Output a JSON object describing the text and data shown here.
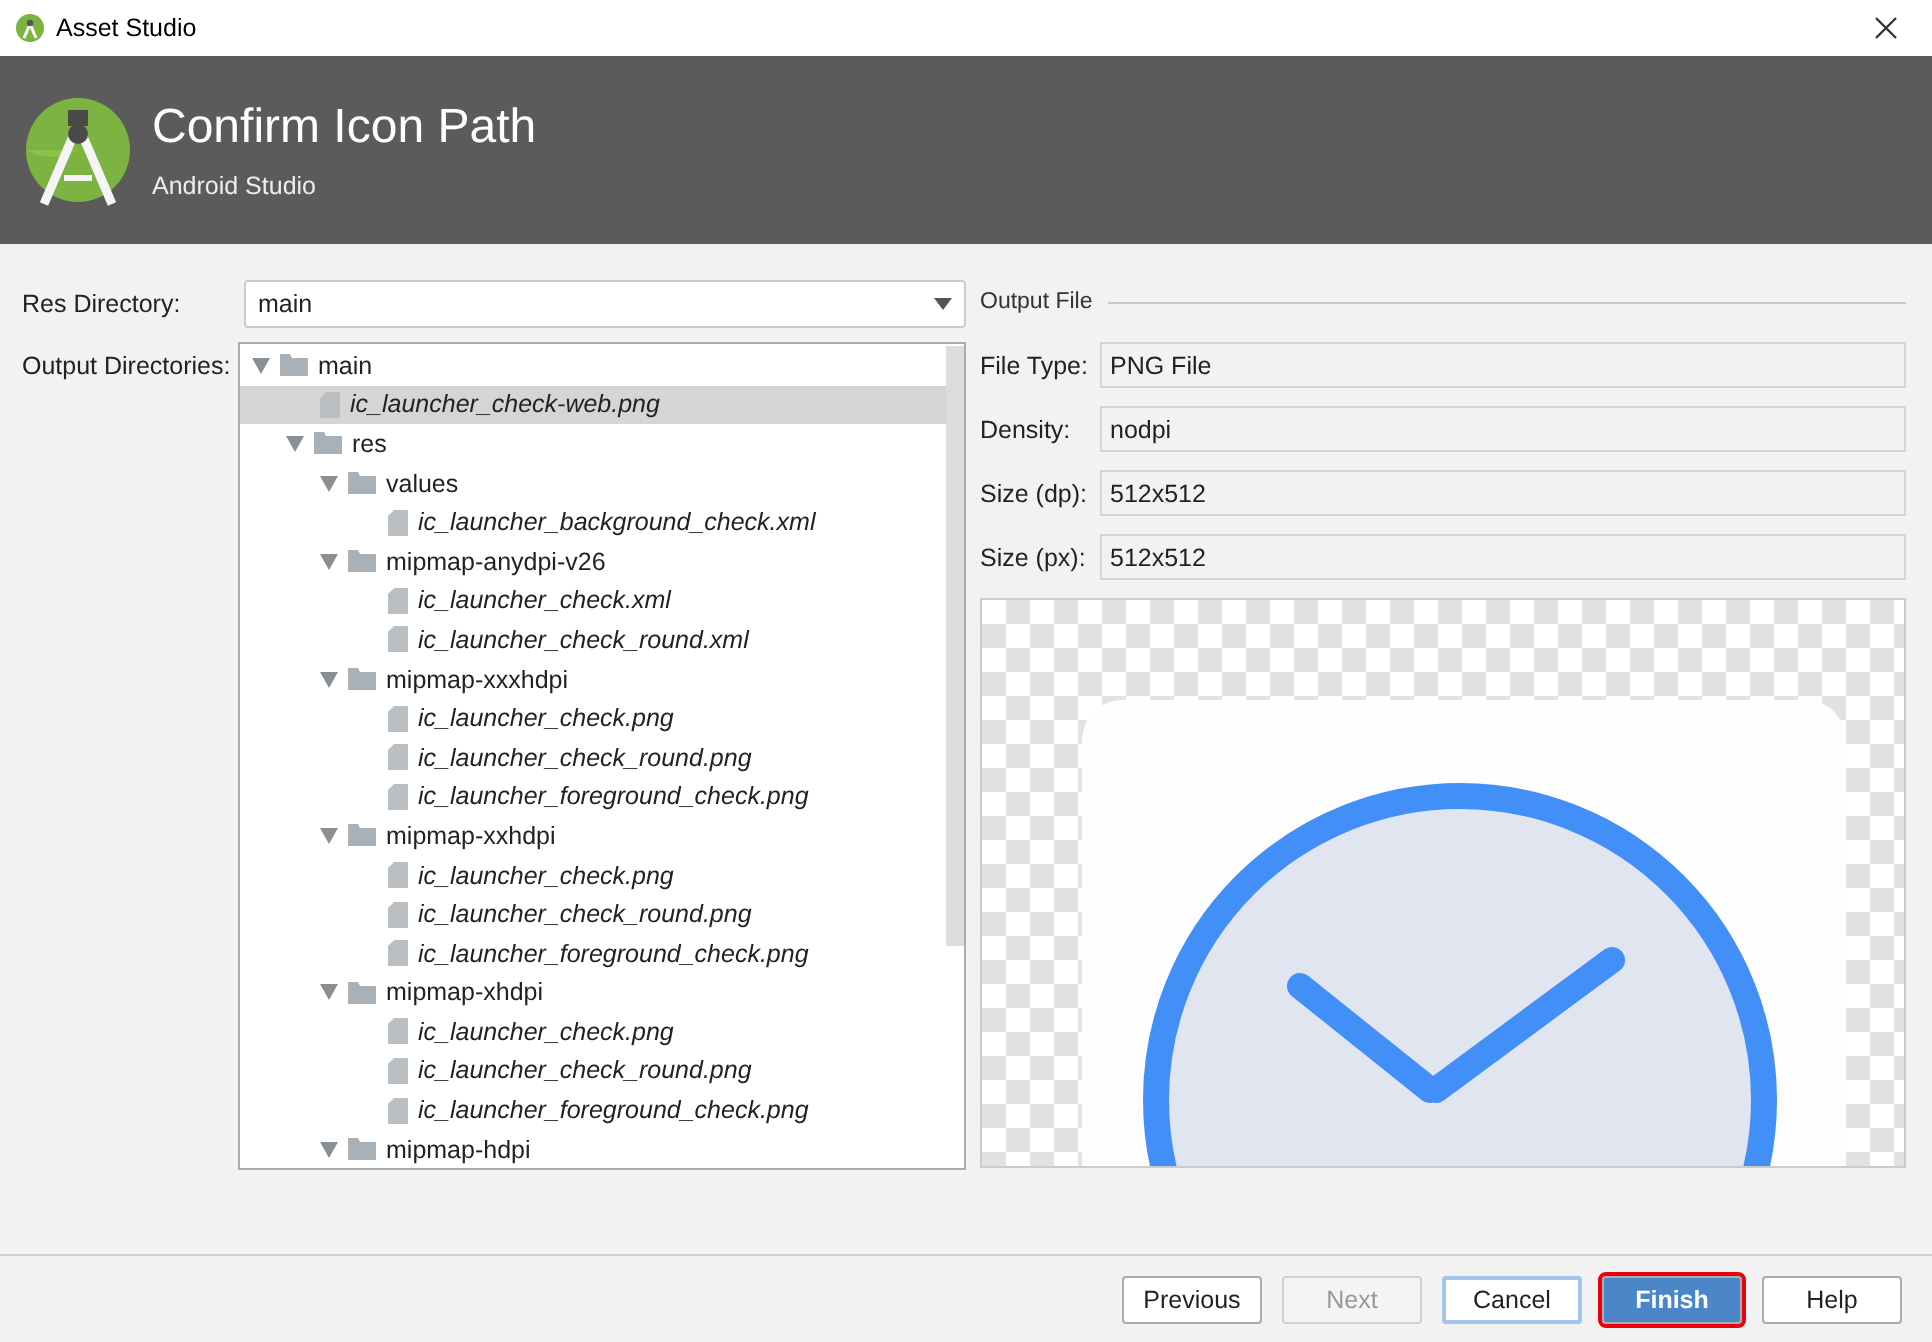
{
  "window": {
    "title": "Asset Studio"
  },
  "header": {
    "title": "Confirm Icon Path",
    "subtitle": "Android Studio"
  },
  "res_directory": {
    "label": "Res Directory:",
    "value": "main"
  },
  "output_directories": {
    "label": "Output Directories:",
    "tree": [
      {
        "label": "main",
        "kind": "folder",
        "expanded": true,
        "selected": false,
        "children": [
          {
            "label": "ic_launcher_check-web.png",
            "kind": "file",
            "selected": true
          },
          {
            "label": "res",
            "kind": "folder",
            "expanded": true,
            "selected": false,
            "children": [
              {
                "label": "values",
                "kind": "folder",
                "expanded": true,
                "selected": false,
                "children": [
                  {
                    "label": "ic_launcher_background_check.xml",
                    "kind": "file",
                    "selected": false
                  }
                ]
              },
              {
                "label": "mipmap-anydpi-v26",
                "kind": "folder",
                "expanded": true,
                "selected": false,
                "children": [
                  {
                    "label": "ic_launcher_check.xml",
                    "kind": "file",
                    "selected": false
                  },
                  {
                    "label": "ic_launcher_check_round.xml",
                    "kind": "file",
                    "selected": false
                  }
                ]
              },
              {
                "label": "mipmap-xxxhdpi",
                "kind": "folder",
                "expanded": true,
                "selected": false,
                "children": [
                  {
                    "label": "ic_launcher_check.png",
                    "kind": "file",
                    "selected": false
                  },
                  {
                    "label": "ic_launcher_check_round.png",
                    "kind": "file",
                    "selected": false
                  },
                  {
                    "label": "ic_launcher_foreground_check.png",
                    "kind": "file",
                    "selected": false
                  }
                ]
              },
              {
                "label": "mipmap-xxhdpi",
                "kind": "folder",
                "expanded": true,
                "selected": false,
                "children": [
                  {
                    "label": "ic_launcher_check.png",
                    "kind": "file",
                    "selected": false
                  },
                  {
                    "label": "ic_launcher_check_round.png",
                    "kind": "file",
                    "selected": false
                  },
                  {
                    "label": "ic_launcher_foreground_check.png",
                    "kind": "file",
                    "selected": false
                  }
                ]
              },
              {
                "label": "mipmap-xhdpi",
                "kind": "folder",
                "expanded": true,
                "selected": false,
                "children": [
                  {
                    "label": "ic_launcher_check.png",
                    "kind": "file",
                    "selected": false
                  },
                  {
                    "label": "ic_launcher_check_round.png",
                    "kind": "file",
                    "selected": false
                  },
                  {
                    "label": "ic_launcher_foreground_check.png",
                    "kind": "file",
                    "selected": false
                  }
                ]
              },
              {
                "label": "mipmap-hdpi",
                "kind": "folder",
                "expanded": true,
                "selected": false
              }
            ]
          }
        ]
      }
    ]
  },
  "output_file": {
    "title": "Output File",
    "fields": [
      {
        "label": "File Type:",
        "value": "PNG File"
      },
      {
        "label": "Density:",
        "value": "nodpi"
      },
      {
        "label": "Size (dp):",
        "value": "512x512"
      },
      {
        "label": "Size (px):",
        "value": "512x512"
      }
    ]
  },
  "buttons": [
    {
      "label": "Previous",
      "disabled": false,
      "focused": false,
      "default": false,
      "highlighted": false
    },
    {
      "label": "Next",
      "disabled": true,
      "focused": false,
      "default": false,
      "highlighted": false
    },
    {
      "label": "Cancel",
      "disabled": false,
      "focused": true,
      "default": false,
      "highlighted": false
    },
    {
      "label": "Finish",
      "disabled": false,
      "focused": false,
      "default": true,
      "highlighted": true
    },
    {
      "label": "Help",
      "disabled": false,
      "focused": false,
      "default": false,
      "highlighted": false
    }
  ]
}
